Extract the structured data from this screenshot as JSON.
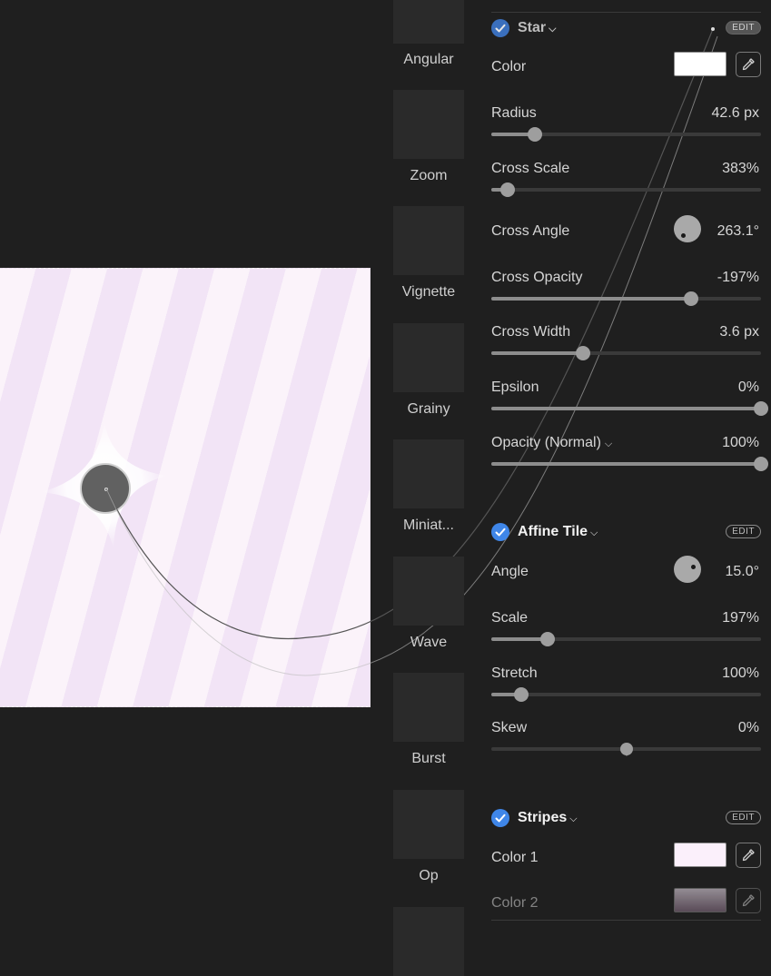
{
  "presets": [
    {
      "label": "Angular"
    },
    {
      "label": "Zoom"
    },
    {
      "label": "Vignette"
    },
    {
      "label": "Grainy"
    },
    {
      "label": "Miniat..."
    },
    {
      "label": "Wave"
    },
    {
      "label": "Burst"
    },
    {
      "label": "Op"
    }
  ],
  "star": {
    "title": "Star",
    "edit_label": "EDIT",
    "color_label": "Color",
    "color_value": "#ffffff",
    "radius": {
      "label": "Radius",
      "value": "42.6 px",
      "fraction": 0.16
    },
    "cross_scale": {
      "label": "Cross Scale",
      "value": "383%",
      "fraction": 0.06
    },
    "cross_angle": {
      "label": "Cross Angle",
      "value": "263.1°"
    },
    "cross_opacity": {
      "label": "Cross Opacity",
      "value": "-197%",
      "fraction": 0.74
    },
    "cross_width": {
      "label": "Cross Width",
      "value": "3.6 px",
      "fraction": 0.34
    },
    "epsilon": {
      "label": "Epsilon",
      "value": "0%",
      "fraction": 1.0
    },
    "opacity": {
      "label": "Opacity (Normal)",
      "value": "100%",
      "fraction": 1.0
    }
  },
  "affine_tile": {
    "title": "Affine Tile",
    "edit_label": "EDIT",
    "angle": {
      "label": "Angle",
      "value": "15.0°"
    },
    "scale": {
      "label": "Scale",
      "value": "197%",
      "fraction": 0.21
    },
    "stretch": {
      "label": "Stretch",
      "value": "100%",
      "fraction": 0.11
    },
    "skew": {
      "label": "Skew",
      "value": "0%",
      "fraction": 0.5
    }
  },
  "stripes": {
    "title": "Stripes",
    "edit_label": "EDIT",
    "color1": {
      "label": "Color 1",
      "value": "#fbf0fb"
    },
    "color2": {
      "label": "Color 2"
    }
  },
  "colors": {
    "accent": "#3f86e8",
    "stripe_light": "#fbf3fa",
    "stripe_dark": "#f2e4f6"
  }
}
